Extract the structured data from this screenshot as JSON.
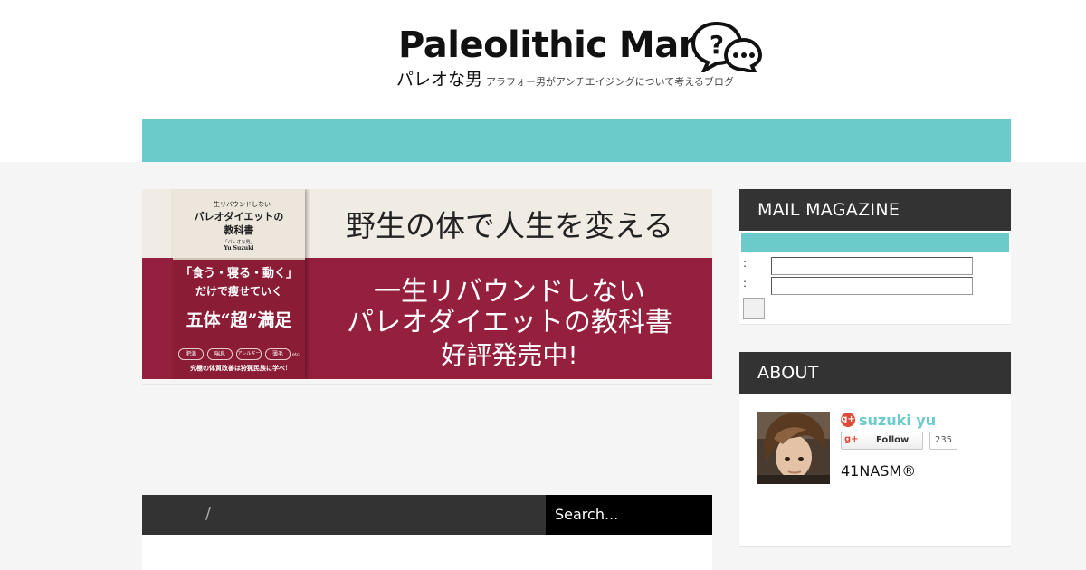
{
  "site": {
    "title": "Paleolithic Man",
    "logo_icon": "speech-bubbles-question-icon",
    "subtitle": "パレオな男",
    "tagline": "アラフォー男がアンチエイジングについて考えるブログ"
  },
  "colors": {
    "accent": "#6bcbcb",
    "dark_bar": "#333333",
    "banner_red": "#95203d",
    "gplus": "#dd4b39"
  },
  "banner": {
    "headline": "野生の体で人生を変える",
    "line1": "一生リバウンドしない",
    "line2": "パレオダイエットの教科書",
    "line3": "好評発売中!",
    "book": {
      "kicker": "一生リバウンドしない",
      "title_line1": "パレオダイエットの",
      "title_line2": "教科書",
      "author_jp": "「パレオな男」",
      "author_en": "Yu Suzuki",
      "catch1": "「食う・寝る・動く」",
      "catch2": "だけで痩せていく",
      "catch3": "五体“超”満足",
      "chips": [
        "肥満",
        "喘息",
        "アレルギー",
        "薄毛"
      ],
      "etc": "etc.",
      "footer": "究極の体質改善は狩猟民族に学べ!"
    }
  },
  "breadcrumb": {
    "separator": "/"
  },
  "search": {
    "placeholder": "Search..."
  },
  "sidebar": {
    "mail": {
      "title": "MAIL MAGAZINE",
      "field_labels": [
        ":",
        ":"
      ]
    },
    "about": {
      "title": "ABOUT",
      "author_name": "suzuki yu",
      "follow_label": "Follow",
      "follow_count": "235",
      "gplus_icon_text": "g+",
      "bio": "41NASM®"
    }
  }
}
